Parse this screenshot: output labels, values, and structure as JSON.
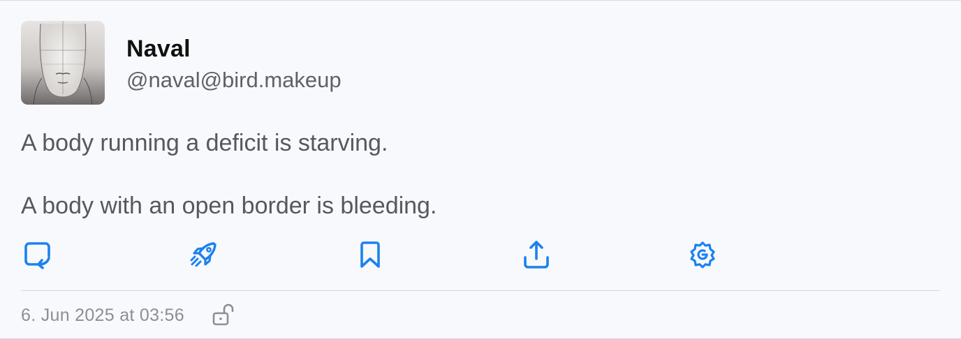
{
  "post": {
    "author": {
      "display_name": "Naval",
      "handle": "@naval@bird.makeup"
    },
    "content": [
      "A body running a deficit is starving.",
      "A body with an open border is bleeding."
    ],
    "timestamp": "6. Jun 2025 at 03:56",
    "visibility_icon": "unlock-icon"
  },
  "actions": [
    {
      "name": "reply",
      "icon": "reply-icon"
    },
    {
      "name": "boost",
      "icon": "rocket-icon"
    },
    {
      "name": "bookmark",
      "icon": "bookmark-icon"
    },
    {
      "name": "share",
      "icon": "share-icon"
    },
    {
      "name": "more",
      "icon": "gear-icon"
    }
  ],
  "colors": {
    "accent": "#1b82ee",
    "background": "#f8f9fd",
    "name_text": "#111111",
    "body_text": "#55585e",
    "muted_text": "#8b8e94"
  }
}
